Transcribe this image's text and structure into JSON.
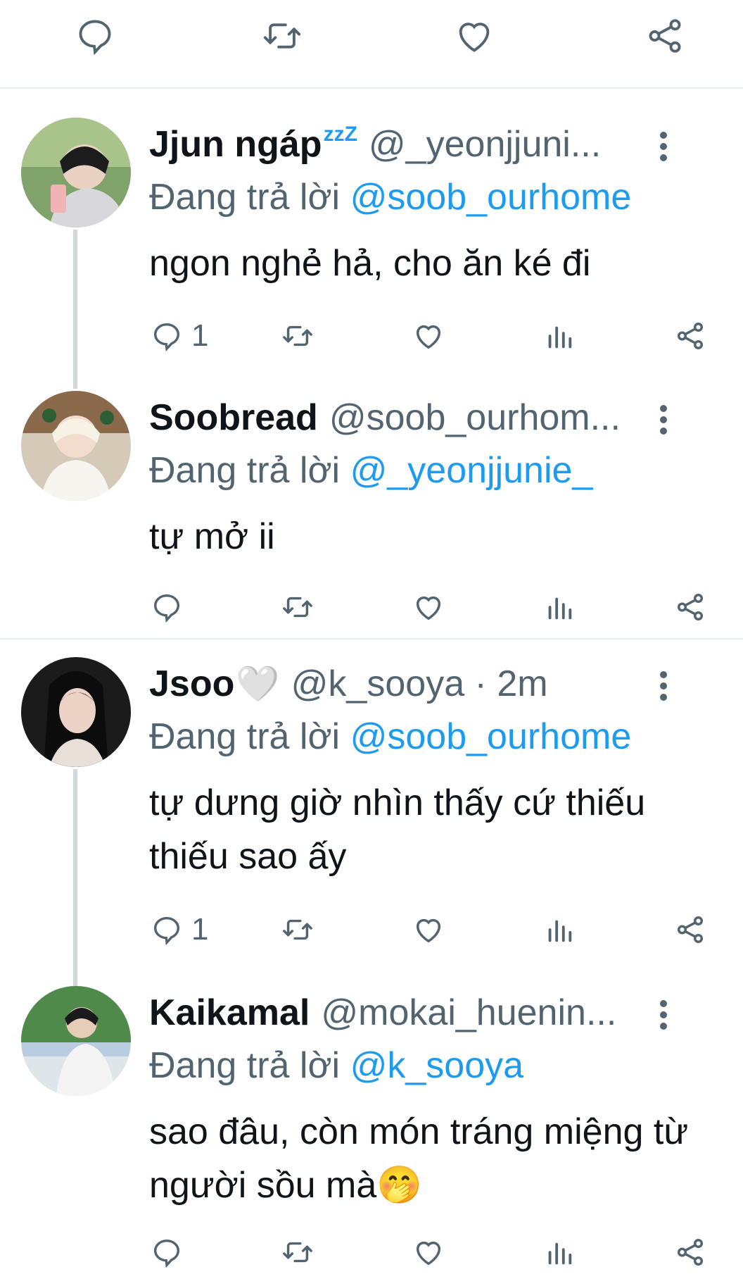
{
  "tweets": [
    {
      "name": "Jjun ngáp",
      "name_suffix": "zzZ",
      "handle": "@_yeonjjuni...",
      "replying_prefix": "Đang trả lời",
      "replying_to": "@soob_ourhome",
      "text": "ngon nghẻ hả, cho ăn ké đi",
      "reply_count": "1"
    },
    {
      "name": "Soobread",
      "handle": "@soob_ourhom...",
      "replying_prefix": "Đang trả lời",
      "replying_to": "@_yeonjjunie_",
      "text": "tự mở ii",
      "reply_count": ""
    },
    {
      "name": "Jsoo",
      "name_suffix": "🤍",
      "handle": "@k_sooya · 2m",
      "replying_prefix": "Đang trả lời",
      "replying_to": "@soob_ourhome",
      "text": "tự dưng giờ nhìn thấy cứ thiếu thiếu sao ấy",
      "reply_count": "1"
    },
    {
      "name": "Kaikamal",
      "handle": "@mokai_huenin...",
      "replying_prefix": "Đang trả lời",
      "replying_to": "@k_sooya",
      "text": "sao đâu, còn món tráng miệng từ người sồu mà🤭",
      "reply_count": ""
    }
  ],
  "icons": {
    "reply": "reply-icon",
    "retweet": "retweet-icon",
    "like": "heart-icon",
    "views": "views-icon",
    "share": "share-icon",
    "more": "more-vertical-icon"
  },
  "colors": {
    "accent": "#1d9bf0",
    "text": "#0f1419",
    "muted": "#536471",
    "divider": "#e6ecf0",
    "thread_line": "#cfd9de"
  }
}
